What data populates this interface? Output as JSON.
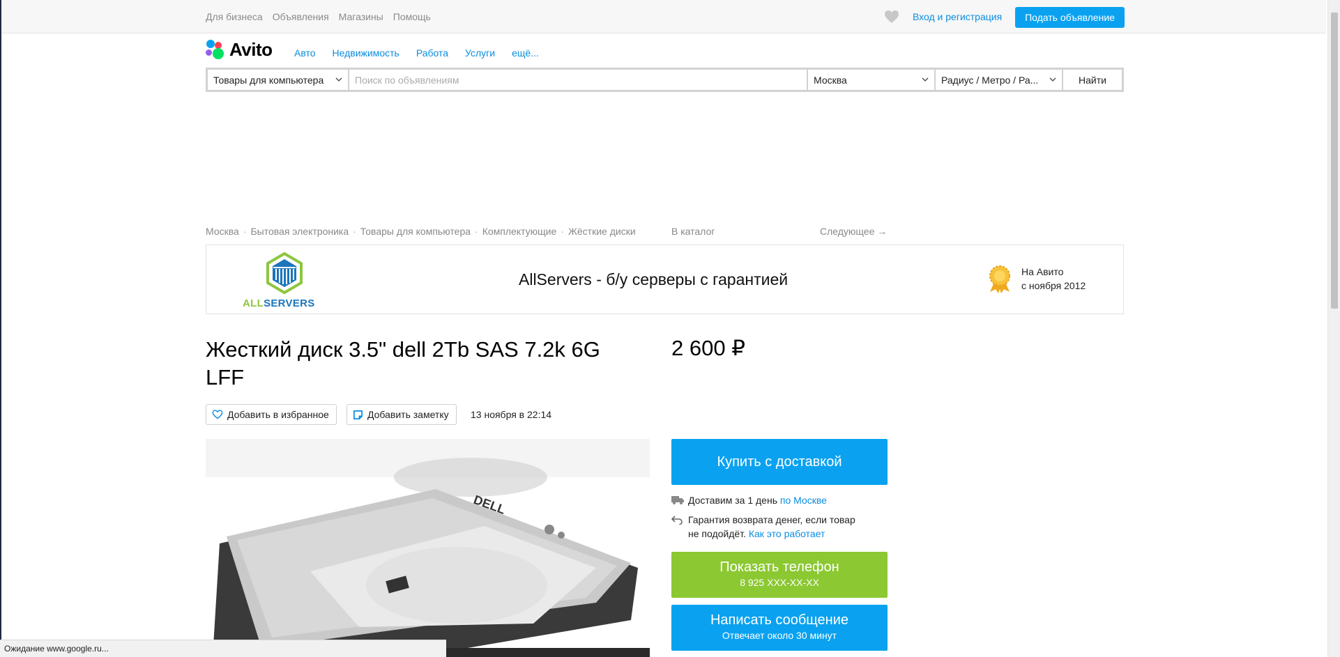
{
  "topbar": {
    "links": [
      "Для бизнеса",
      "Объявления",
      "Магазины",
      "Помощь"
    ],
    "login": "Вход и регистрация",
    "post_ad": "Подать объявление"
  },
  "logo": {
    "text": "Avito"
  },
  "nav": [
    "Авто",
    "Недвижимость",
    "Работа",
    "Услуги",
    "ещё..."
  ],
  "search": {
    "category": "Товары для компьютера",
    "placeholder": "Поиск по объявлениям",
    "city": "Москва",
    "radius": "Радиус / Метро / Ра...",
    "submit": "Найти"
  },
  "breadcrumbs": [
    "Москва",
    "Бытовая электроника",
    "Товары для компьютера",
    "Комплектующие",
    "Жёсткие диски"
  ],
  "catalog_link": "В каталог",
  "next_link": "Следующее →",
  "shop": {
    "logo_text_a": "ALL",
    "logo_text_b": "SERVERS",
    "title": "AllServers - б/у серверы с гарантией",
    "since_line1": "На Авито",
    "since_line2": "с ноября 2012"
  },
  "listing": {
    "title": "Жесткий диск 3.5\" dell 2Tb SAS 7.2k 6G LFF",
    "price": "2 600 ₽",
    "favorite": "Добавить в избранное",
    "note": "Добавить заметку",
    "date": "13 ноября в 22:14",
    "photo_brand": "DELL"
  },
  "actions": {
    "buy": "Купить с доставкой",
    "delivery_text": "Доставим за 1 день ",
    "delivery_link": "по Москве",
    "guarantee_text1": "Гарантия возврата денег, если товар",
    "guarantee_text2": "не подойдёт. ",
    "guarantee_link": "Как это работает",
    "phone_title": "Показать телефон",
    "phone_number": "8 925 XXX-XX-XX",
    "message_title": "Написать сообщение",
    "message_sub": "Отвечает около 30 минут"
  },
  "status": "Ожидание www.google.ru...",
  "colors": {
    "accent_blue": "#0aa2f0",
    "link_blue": "#0a8de0",
    "green": "#8bc832"
  }
}
